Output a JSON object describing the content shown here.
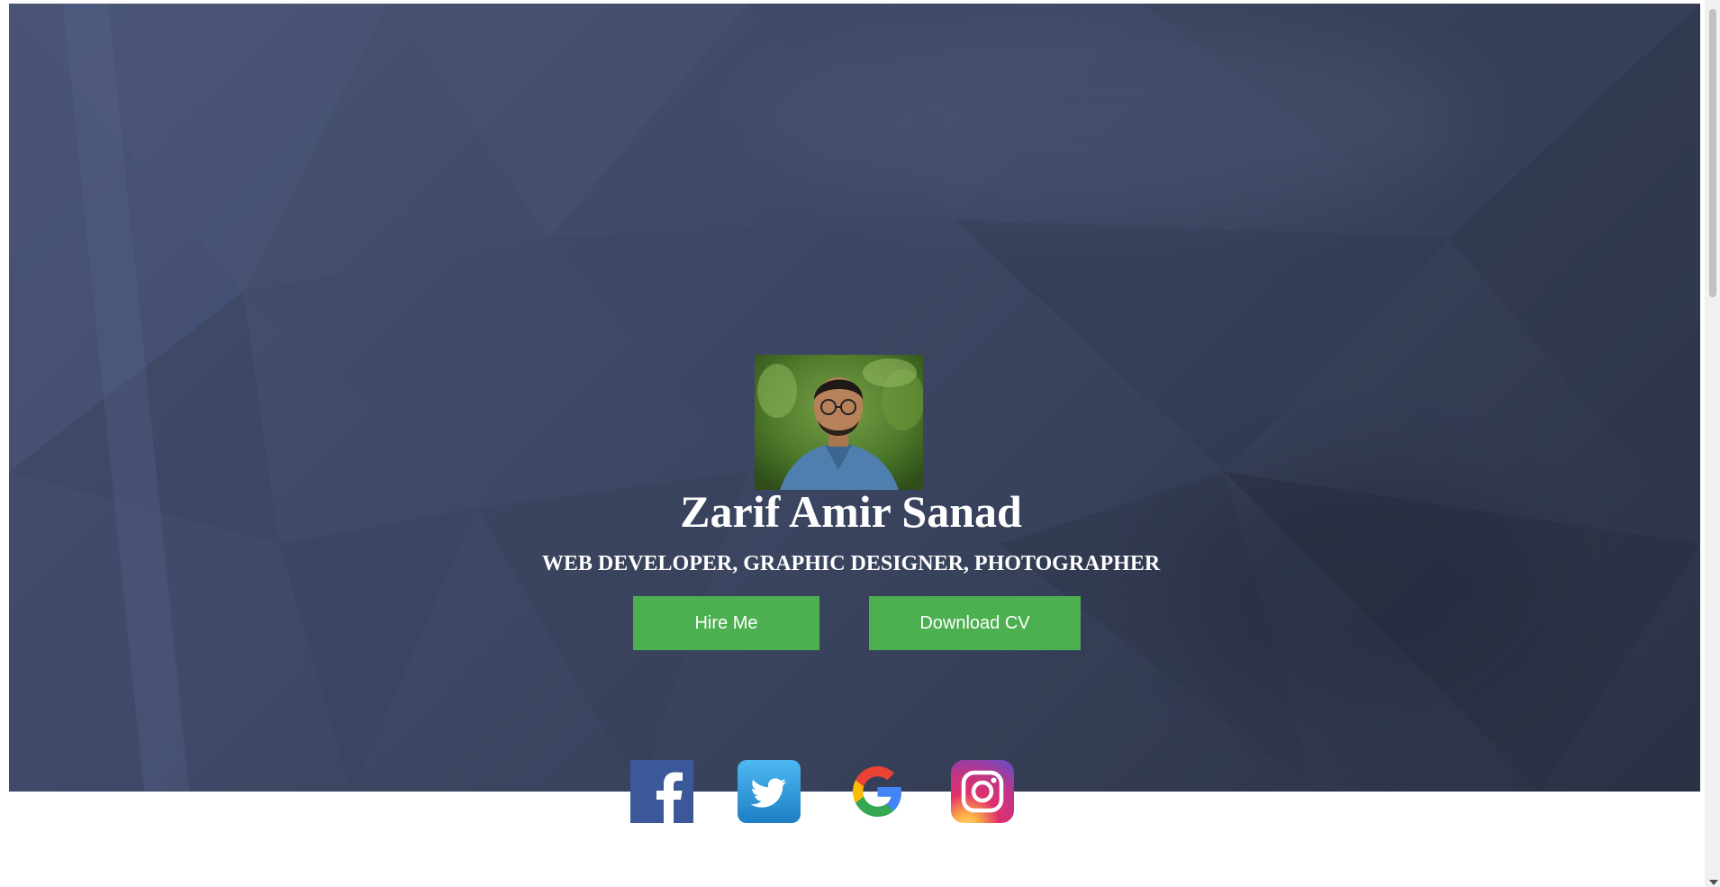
{
  "hero": {
    "name": "Zarif Amir Sanad",
    "tagline": "WEB DEVELOPER, GRAPHIC DESIGNER, PHOTOGRAPHER",
    "profile_image": "profile-photo",
    "buttons": {
      "hire_label": "Hire Me",
      "download_label": "Download CV"
    }
  },
  "social": [
    {
      "name": "facebook-icon",
      "color": "#3b5998"
    },
    {
      "name": "twitter-icon",
      "color": "#2aa3ef"
    },
    {
      "name": "google-icon",
      "color": "#4285f4"
    },
    {
      "name": "instagram-icon",
      "color": "#c13584"
    }
  ],
  "colors": {
    "accent": "#4caf50",
    "hero_bg": "#3f4a68",
    "text": "#ffffff"
  }
}
